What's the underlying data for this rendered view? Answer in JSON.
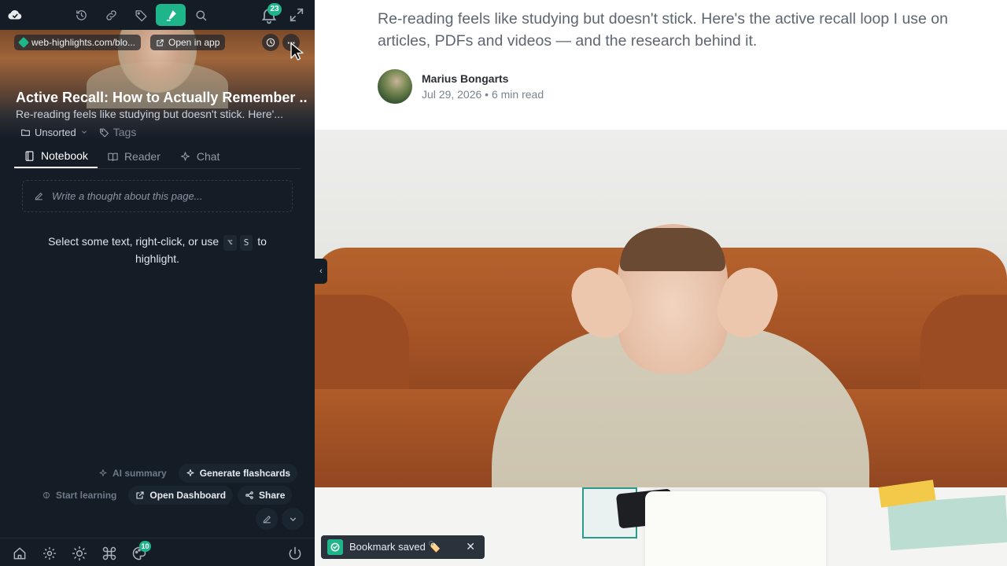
{
  "toolbar": {
    "notification_count": "23",
    "tools": [
      "history-icon",
      "link-icon",
      "tag-icon",
      "highlighter-icon",
      "search-icon"
    ],
    "active_tool": "highlighter-icon",
    "accent": "#1fb58a"
  },
  "page": {
    "source_chip": "web-highlights.com/blo...",
    "open_in_app": "Open in app",
    "title": "Active Recall: How to Actually Remember ...",
    "subtitle": "Re-reading feels like studying but doesn't stick. Here'...",
    "folder": "Unsorted",
    "tags_placeholder": "Tags"
  },
  "tabs": [
    {
      "label": "Notebook",
      "active": true
    },
    {
      "label": "Reader",
      "active": false
    },
    {
      "label": "Chat",
      "active": false
    }
  ],
  "notebook": {
    "placeholder": "Write a thought about this page...",
    "hint_before": "Select some text, right-click, or use",
    "key1": "⌥",
    "key2": "S",
    "hint_after": "to highlight."
  },
  "actions": {
    "ai_summary": "AI summary",
    "generate_flashcards": "Generate flashcards",
    "start_learning": "Start learning",
    "open_dashboard": "Open Dashboard",
    "share": "Share"
  },
  "bottombar": {
    "badge_count": "10"
  },
  "article": {
    "lede": "Re-reading feels like studying but doesn't stick. Here's the active recall loop I use on articles, PDFs and videos — and the research behind it.",
    "author_name": "Marius Bongarts",
    "author_meta": "Jul 29, 2026 • 6 min read"
  },
  "toast": {
    "message": "Bookmark saved 🏷️"
  }
}
